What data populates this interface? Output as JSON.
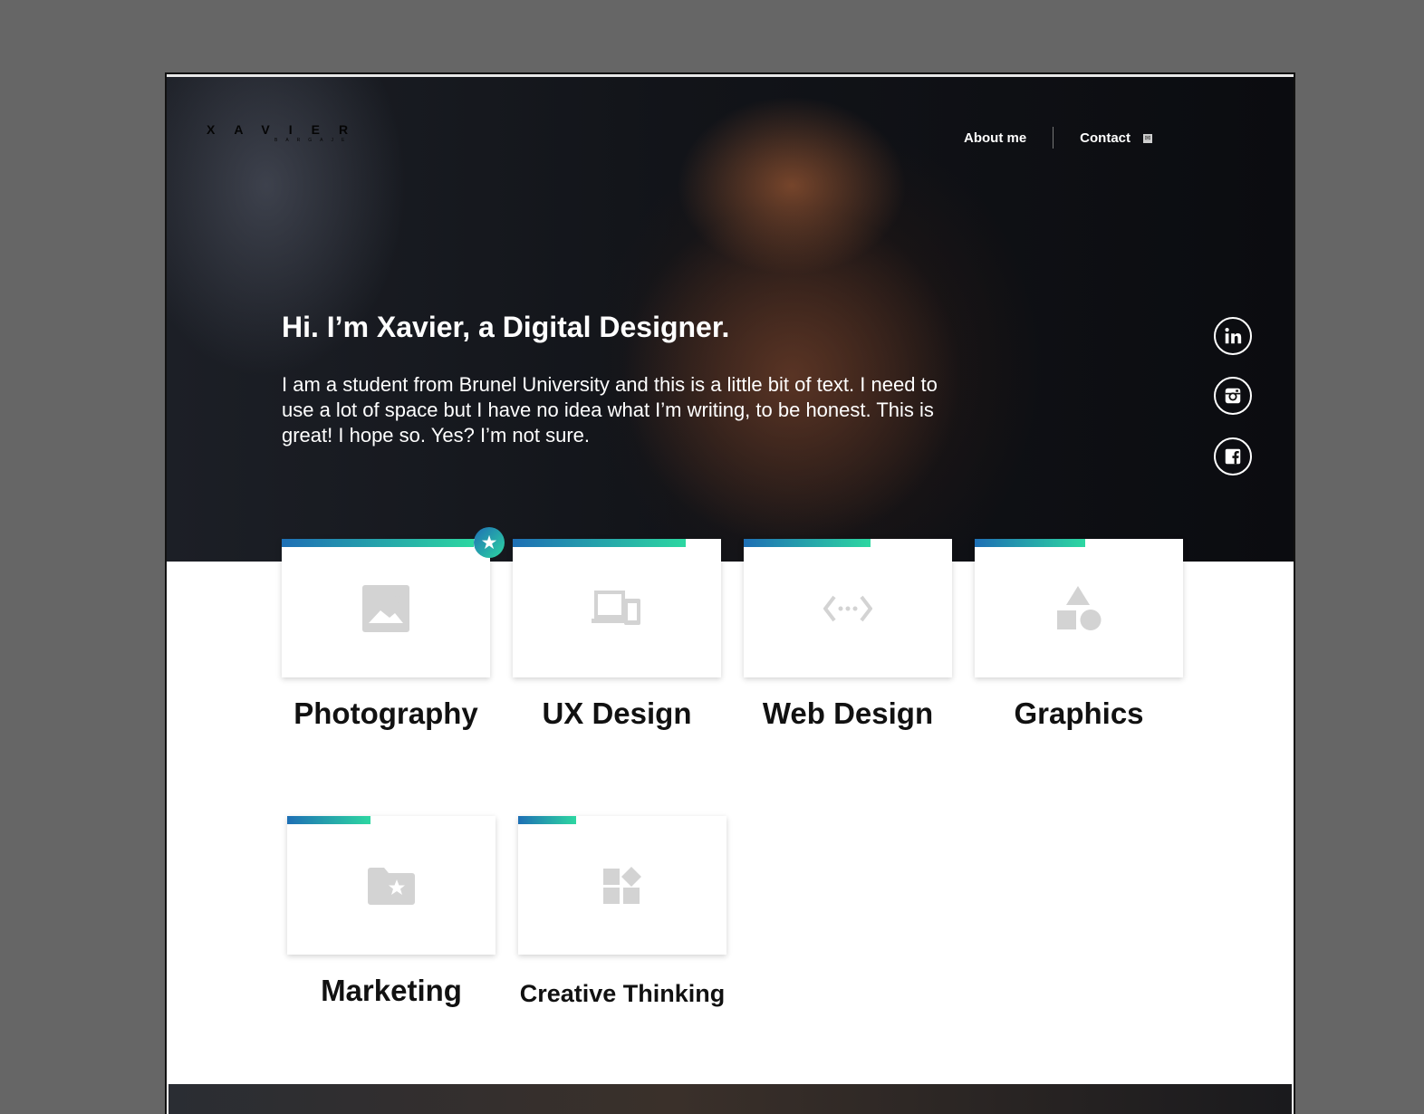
{
  "logo": {
    "name": "XAVIER",
    "tagline": "BARGAJE"
  },
  "nav": {
    "about": "About me",
    "contact": "Contact"
  },
  "hero": {
    "headline": "Hi. I’m Xavier, a Digital Designer.",
    "intro": "I am a student from Brunel University and this is a little bit of text. I need to use a lot of space but I have no idea what I’m writing, to be honest. This is great! I hope so. Yes? I’m not sure."
  },
  "social": [
    "linkedin-icon",
    "instagram-icon",
    "facebook-icon"
  ],
  "skills": [
    {
      "label": "Photography",
      "icon": "image-icon",
      "progress": 0.92,
      "featured": true
    },
    {
      "label": "UX Design",
      "icon": "devices-icon",
      "progress": 0.83
    },
    {
      "label": "Web Design",
      "icon": "code-icon",
      "progress": 0.61
    },
    {
      "label": "Graphics",
      "icon": "shapes-icon",
      "progress": 0.53
    },
    {
      "label": "Marketing",
      "icon": "folder-star-icon",
      "progress": 0.4
    },
    {
      "label": "Creative Thinking",
      "icon": "widgets-icon",
      "progress": 0.28
    }
  ],
  "colors": {
    "accent_start": "#1e6fb5",
    "accent_end": "#2dd7a1",
    "icon_grey": "#d3d3d3"
  }
}
